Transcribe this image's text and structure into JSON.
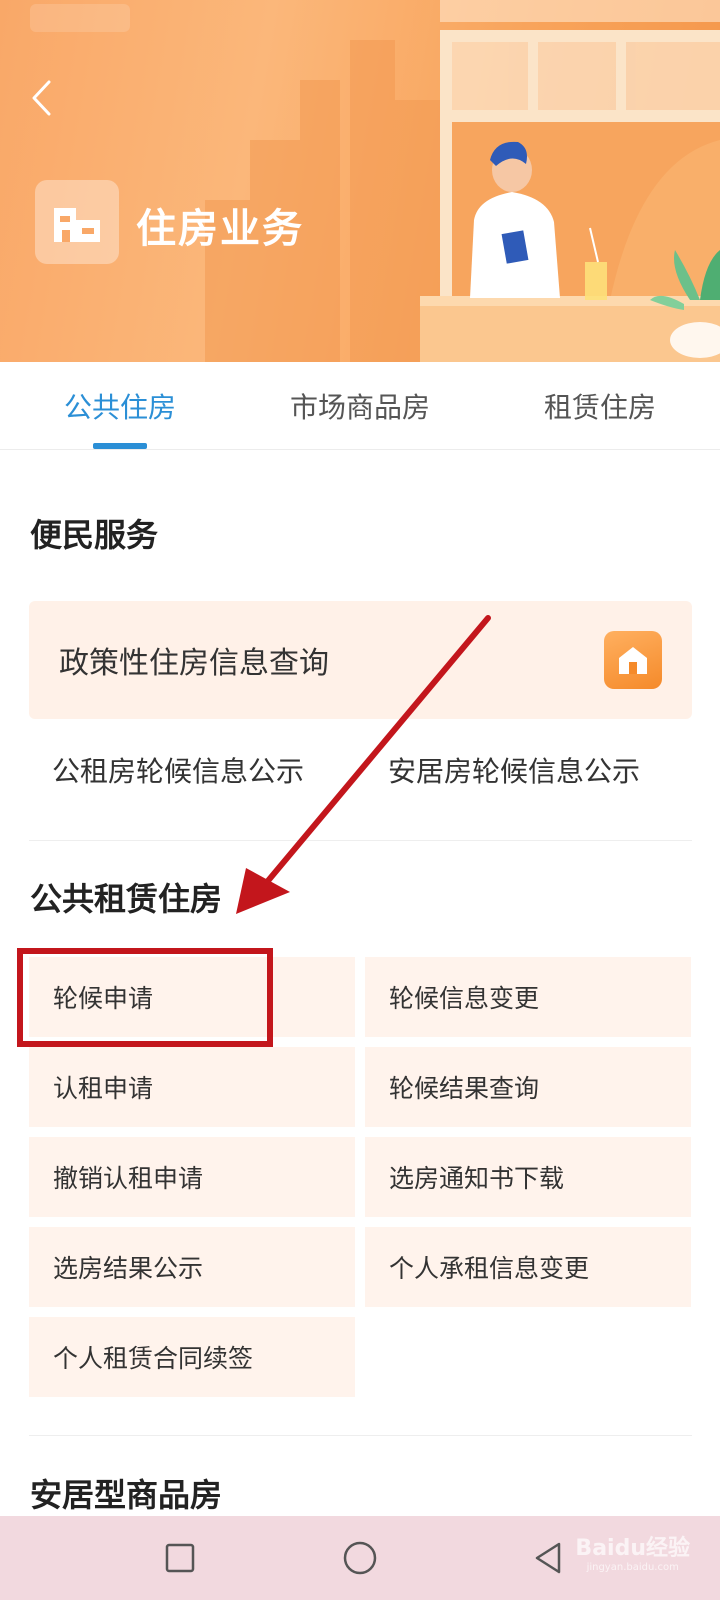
{
  "header": {
    "title": "住房业务",
    "back_icon": "chevron-left-icon",
    "banner_icon": "building-icon"
  },
  "tabs": [
    {
      "label": "公共住房",
      "active": true
    },
    {
      "label": "市场商品房",
      "active": false
    },
    {
      "label": "租赁住房",
      "active": false
    }
  ],
  "convenience": {
    "title": "便民服务",
    "policy_query_label": "政策性住房信息查询",
    "policy_icon": "house-icon",
    "links": [
      "公租房轮候信息公示",
      "安居房轮候信息公示"
    ]
  },
  "public_rental": {
    "title": "公共租赁住房",
    "items": [
      "轮候申请",
      "轮候信息变更",
      "认租申请",
      "轮候结果查询",
      "撤销认租申请",
      "选房通知书下载",
      "选房结果公示",
      "个人承租信息变更",
      "个人租赁合同续签"
    ]
  },
  "affordable": {
    "title": "安居型商品房"
  },
  "navbar": {
    "buttons": [
      "recent-apps-icon",
      "home-icon",
      "back-icon"
    ]
  },
  "watermark": {
    "text": "Baidu经验",
    "sub": "jingyan.baidu.com"
  },
  "colors": {
    "accent": "#2b8fd6",
    "banner": "#f8a35a",
    "card_bg": "#fff3ec",
    "highlight": "#c3161c"
  }
}
